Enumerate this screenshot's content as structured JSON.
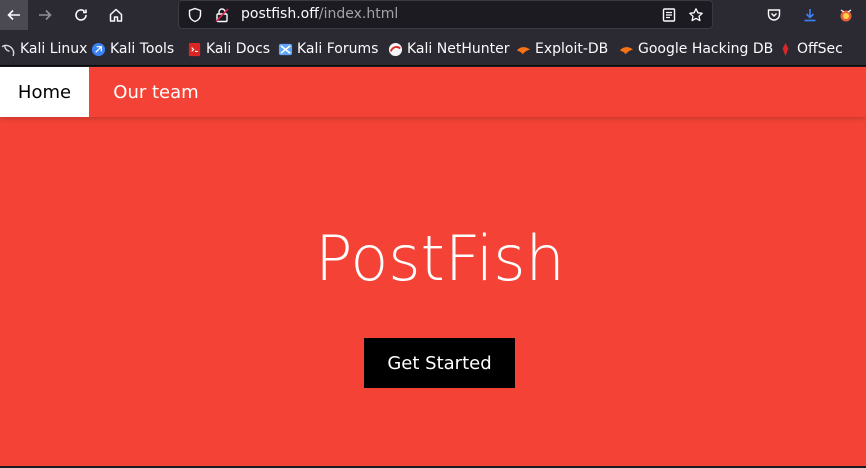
{
  "browser": {
    "url_host": "postfish.off",
    "url_path": "/index.html",
    "icons": [
      "back-icon",
      "forward-icon",
      "reload-icon",
      "home-icon",
      "shield-icon",
      "lock-icon",
      "reader-view-icon",
      "bookmark-star-icon",
      "pocket-icon",
      "downloads-icon",
      "extension-icon"
    ]
  },
  "bookmarks": [
    {
      "label": "Kali Linux",
      "icon": "kali-dragon-icon"
    },
    {
      "label": "Kali Tools",
      "icon": "kali-tools-icon"
    },
    {
      "label": "Kali Docs",
      "icon": "kali-docs-icon"
    },
    {
      "label": "Kali Forums",
      "icon": "kali-forums-icon"
    },
    {
      "label": "Kali NetHunter",
      "icon": "nethunter-icon"
    },
    {
      "label": "Exploit-DB",
      "icon": "exploit-db-icon"
    },
    {
      "label": "Google Hacking DB",
      "icon": "ghdb-icon"
    },
    {
      "label": "OffSec",
      "icon": "offsec-icon"
    }
  ],
  "site": {
    "nav": {
      "home": "Home",
      "team": "Our team"
    },
    "hero_title": "PostFish",
    "cta_label": "Get Started"
  },
  "colors": {
    "brand_red": "#f44336",
    "browser_chrome": "#2b2a33",
    "cta_background": "#000000"
  }
}
